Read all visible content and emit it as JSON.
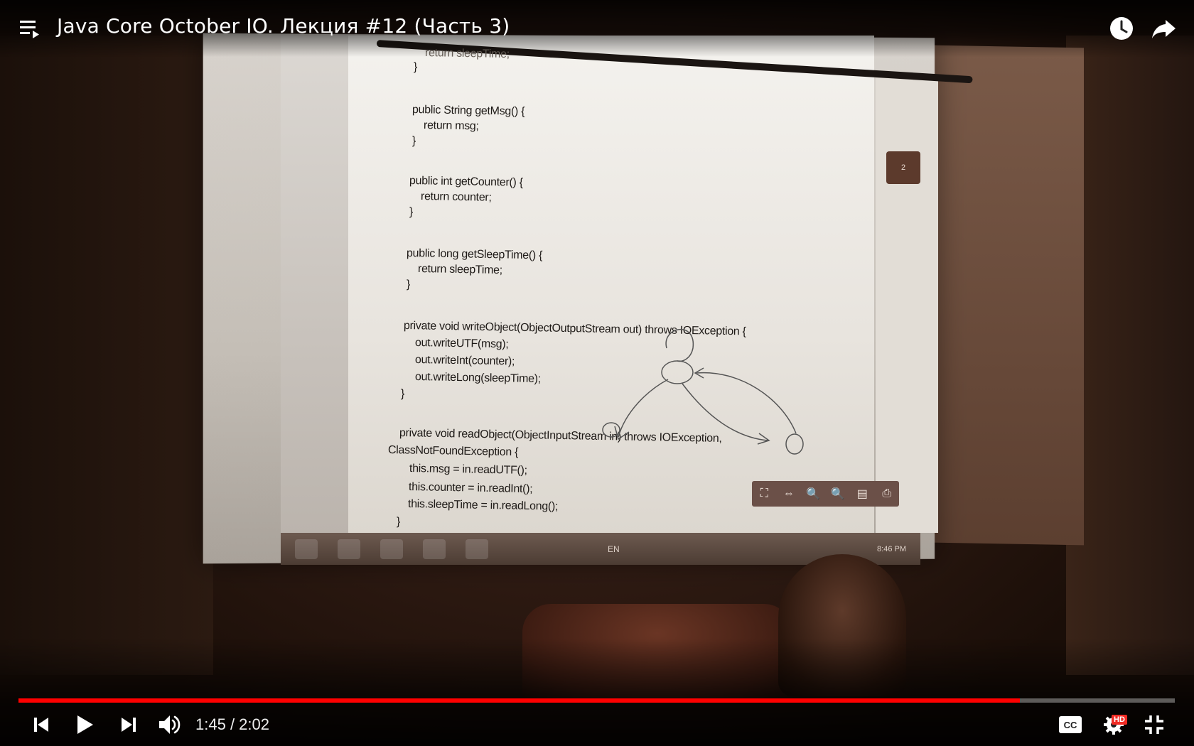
{
  "player": {
    "title": "Java Core October IO. Лекция #12 (Часть 3)",
    "current_time": "1:45",
    "duration": "2:02",
    "time_separator": " / ",
    "progress_fraction": 0.866,
    "hd_label": "HD",
    "accent_color": "#ff0000"
  },
  "icons": {
    "playlist": "playlist-icon",
    "watch_later": "clock-icon",
    "share": "share-icon",
    "previous": "skip-previous-icon",
    "play": "play-icon",
    "next": "skip-next-icon",
    "volume": "volume-icon",
    "captions": "cc-icon",
    "settings": "gear-icon",
    "exit_fullscreen": "exit-fullscreen-icon"
  },
  "projection": {
    "code_lines": [
      "return sleepTime;",
      "}",
      "public String getMsg() {",
      "   return msg;",
      "}",
      "public int getCounter() {",
      "   return counter;",
      "}",
      "public long getSleepTime() {",
      "   return sleepTime;",
      "}",
      "private void writeObject(ObjectOutputStream out) throws IOException {",
      "   out.writeUTF(msg);",
      "   out.writeInt(counter);",
      "   out.writeLong(sleepTime);",
      "}",
      "private void readObject(ObjectInputStream in) throws IOException,",
      "ClassNotFoundException {",
      "   this.msg = in.readUTF();",
      "   this.counter = in.readInt();",
      "   this.sleepTime = in.readLong();",
      "}"
    ],
    "page_badge": "2",
    "taskbar_lang": "EN",
    "taskbar_clock": "8:46 PM"
  }
}
